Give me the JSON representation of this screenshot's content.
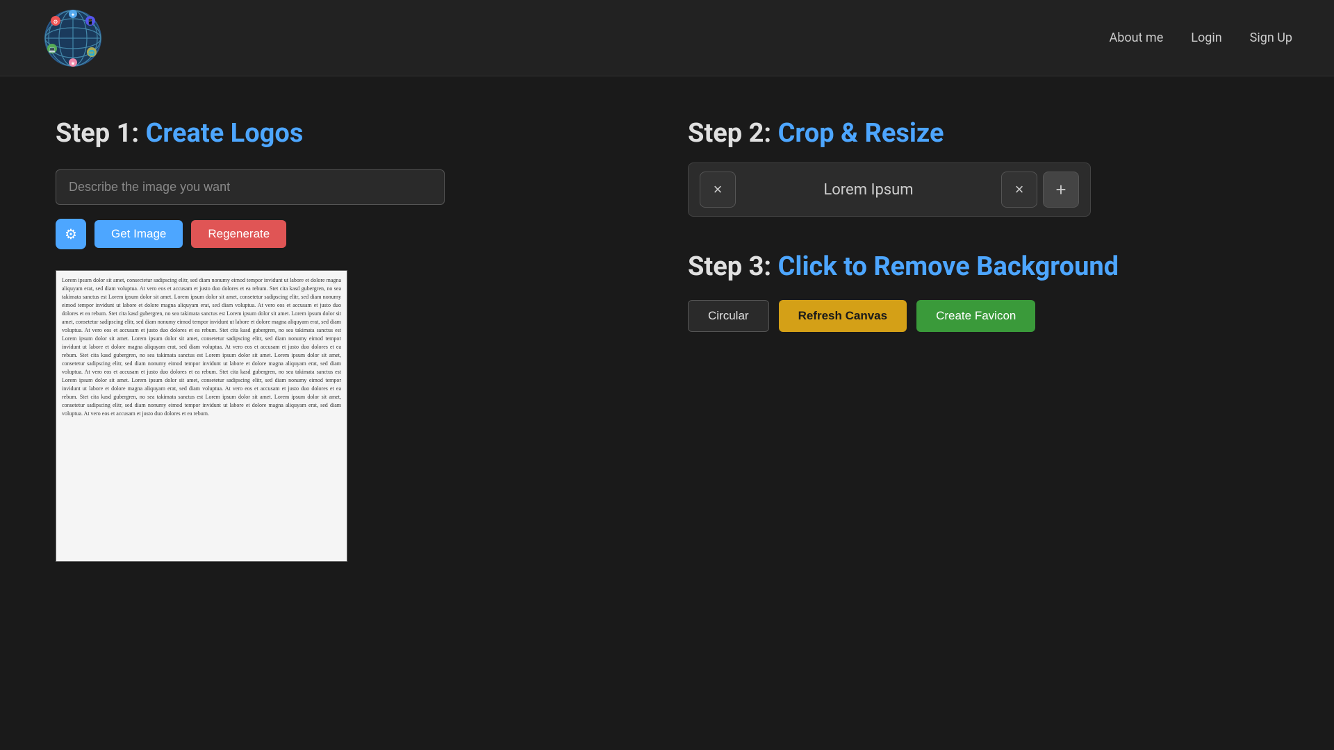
{
  "nav": {
    "logo_alt": "Globe Logo",
    "links": [
      {
        "label": "About me",
        "id": "about-me"
      },
      {
        "label": "Login",
        "id": "login"
      },
      {
        "label": "Sign Up",
        "id": "sign-up"
      }
    ]
  },
  "step1": {
    "number": "Step 1:",
    "title": "Create Logos",
    "input_placeholder": "Describe the image you want",
    "get_image_label": "Get Image",
    "regenerate_label": "Regenerate"
  },
  "step2": {
    "number": "Step 2:",
    "title": "Crop & Resize",
    "crop_bar": {
      "left_x": "×",
      "text": "Lorem Ipsum",
      "right_x": "×",
      "plus": "+"
    }
  },
  "step3": {
    "number": "Step 3:",
    "title": "Click to Remove Background",
    "buttons": {
      "circular": "Circular",
      "refresh_canvas": "Refresh Canvas",
      "create_favicon": "Create Favicon"
    }
  },
  "lorem_ipsum": "Lorem ipsum dolor sit amet, consectetur sadipscing elitr, sed diam nonumy eimod tempor invidunt ut labore et dolore magna aliquyam erat, sed diam voluptua. At vero eos et accusam et justo duo dolores et ea rebum. Stet cita kasd gubergren, no sea takimata sanctus est Lorem ipsum dolor sit amet. Lorem ipsum dolor sit amet, consetetur sadipscing elitr, sed diam nonumy eimod tempor invidunt ut labore et dolore magna aliquyam erat, sed diam voluptua. At vero eos et accusam et justo duo dolores et ea rebum. Stet cita kasd gubergren, no sea takimata sanctus est Lorem ipsum dolor sit amet. Lorem ipsum dolor sit amet, consetetur sadipscing elitr, sed diam nonumy eimod tempor invidunt ut labore et dolore magna aliquyam erat, sed diam voluptua. At vero eos et accusam et justo duo dolores et ea rebum. Stet cita kasd gubergren, no sea takimata sanctus est Lorem ipsum dolor sit amet. Lorem ipsum dolor sit amet, consetetur sadipscing elitr, sed diam nonumy eimod tempor invidunt ut labore et dolore magna aliquyam erat, sed diam voluptua. At vero eos et accusam et justo duo dolores et ea rebum. Stet cita kasd gubergren, no sea takimata sanctus est Lorem ipsum dolor sit amet. Lorem ipsum dolor sit amet, consetetur sadipscing elitr, sed diam nonumy eimod tempor invidunt ut labore et dolore magna aliquyam erat, sed diam voluptua. At vero eos et accusam et justo duo dolores et ea rebum. Stet cita kasd gubergren, no sea takimata sanctus est Lorem ipsum dolor sit amet. Lorem ipsum dolor sit amet, consetetur sadipscing elitr, sed diam nonumy eimod tempor invidunt ut labore et dolore magna aliquyam erat, sed diam voluptua. At vero eos et accusam et justo duo dolores et ea rebum. Stet cita kasd gubergren, no sea takimata sanctus est Lorem ipsum dolor sit amet. Lorem ipsum dolor sit amet, consetetur sadipscing elitr, sed diam nonumy eimod tempor invidunt ut labore et dolore magna aliquyam erat, sed diam voluptua. At vero eos et accusam et justo duo dolores et ea rebum."
}
